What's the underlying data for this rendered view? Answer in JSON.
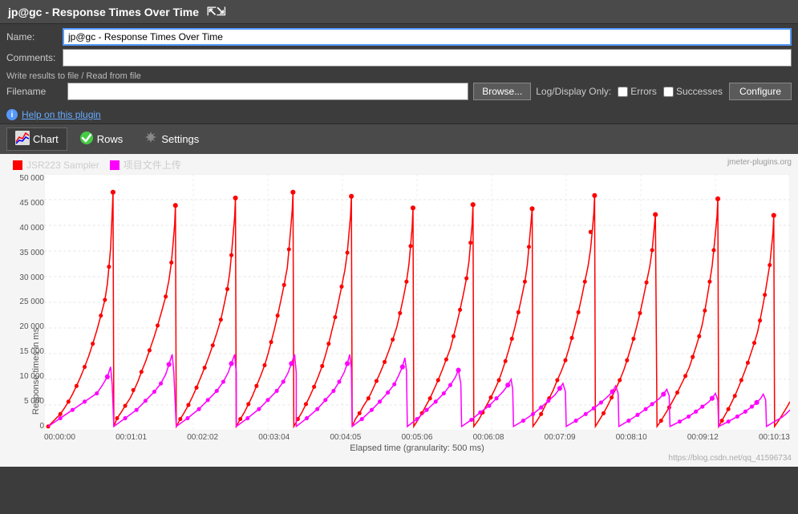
{
  "title": "jp@gc - Response Times Over Time",
  "name_label": "Name:",
  "name_value": "jp@gc - Response Times Over Time",
  "comments_label": "Comments:",
  "comments_value": "",
  "file_section": "Write results to file / Read from file",
  "filename_label": "Filename",
  "filename_value": "",
  "browse_label": "Browse...",
  "log_display_label": "Log/Display Only:",
  "errors_label": "Errors",
  "successes_label": "Successes",
  "configure_label": "Configure",
  "help_text": "Help on this plugin",
  "tabs": [
    {
      "id": "chart",
      "label": "Chart",
      "active": true
    },
    {
      "id": "rows",
      "label": "Rows",
      "active": false
    },
    {
      "id": "settings",
      "label": "Settings",
      "active": false
    }
  ],
  "chart": {
    "watermark": "jmeter-plugins.org",
    "watermark_url": "https://blog.csdn.net/qq_41596734",
    "yaxis_label": "Response times in ms",
    "xaxis_label": "Elapsed time (granularity: 500 ms)",
    "yaxis_values": [
      "50 000",
      "45 000",
      "40 000",
      "35 000",
      "30 000",
      "25 000",
      "20 000",
      "15 000",
      "10 000",
      "5 000",
      "0"
    ],
    "xaxis_values": [
      "00:00:00",
      "00:01:01",
      "00:02:02",
      "00:03:04",
      "00:04:05",
      "00:05:06",
      "00:06:08",
      "00:07:09",
      "00:08:10",
      "00:09:12",
      "00:10:13"
    ],
    "legend": [
      {
        "label": "JSR223 Sampler",
        "color": "#ff0000"
      },
      {
        "label": "项目文件上传",
        "color": "#ff00ff"
      }
    ]
  }
}
